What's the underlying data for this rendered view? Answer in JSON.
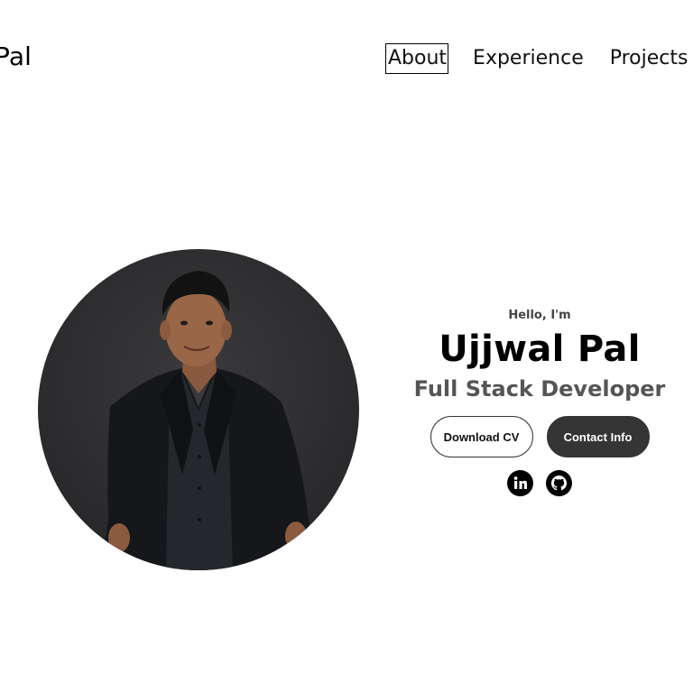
{
  "header": {
    "logo_text": "Pal",
    "nav": {
      "about": "About",
      "experience": "Experience",
      "projects": "Projects"
    }
  },
  "hero": {
    "greeting": "Hello, I'm",
    "name": "Ujjwal Pal",
    "role": "Full Stack Developer",
    "buttons": {
      "download_cv": "Download CV",
      "contact_info": "Contact Info"
    },
    "socials": {
      "linkedin_icon": "linkedin-icon",
      "github_icon": "github-icon"
    }
  },
  "colors": {
    "button_dark": "#353535",
    "role_text": "#555555",
    "portrait_bg": "#2c2c2e"
  }
}
